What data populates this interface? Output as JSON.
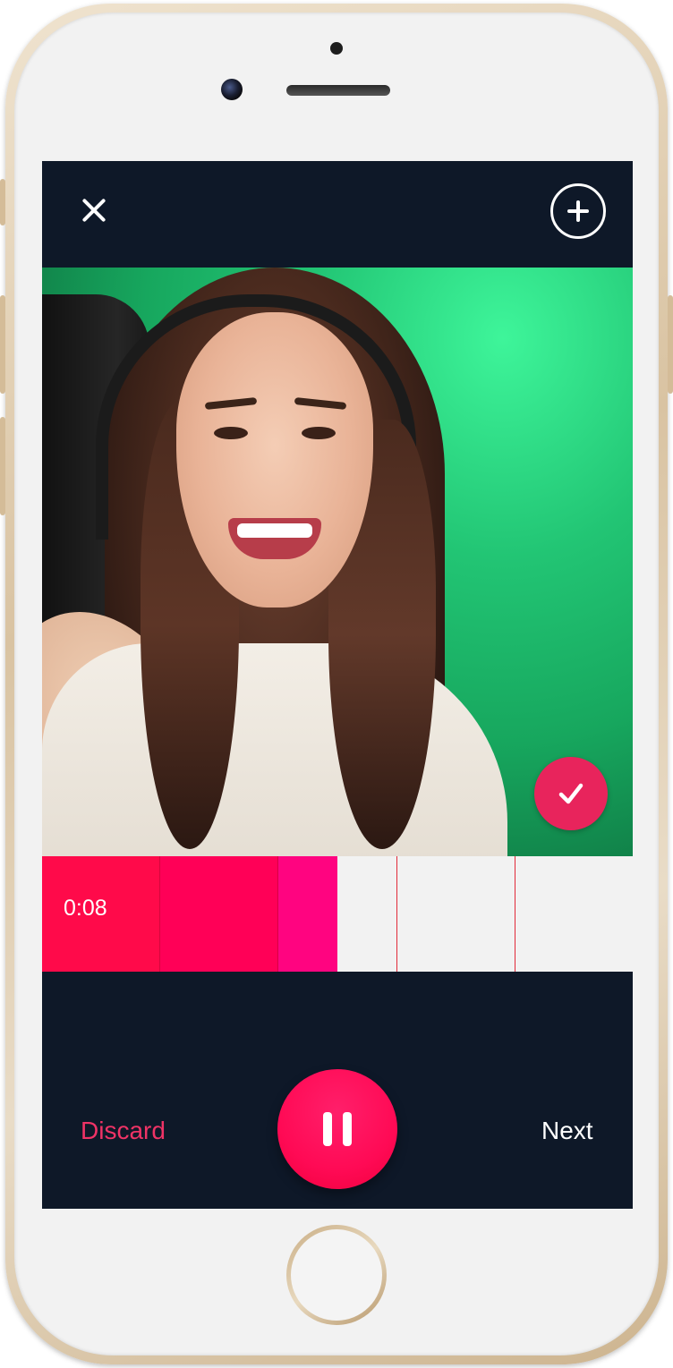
{
  "recorder": {
    "elapsed_time": "0:08",
    "progress_fraction": 0.5,
    "segments_recorded": 3
  },
  "controls": {
    "discard_label": "Discard",
    "next_label": "Next"
  },
  "icons": {
    "close": "close-icon",
    "add": "plus-circle-icon",
    "confirm": "checkmark-icon",
    "pause": "pause-icon"
  },
  "colors": {
    "accent": "#ff0a55",
    "discard_text": "#ef3366",
    "background": "#0e1828",
    "preview_green": "#22c574"
  }
}
